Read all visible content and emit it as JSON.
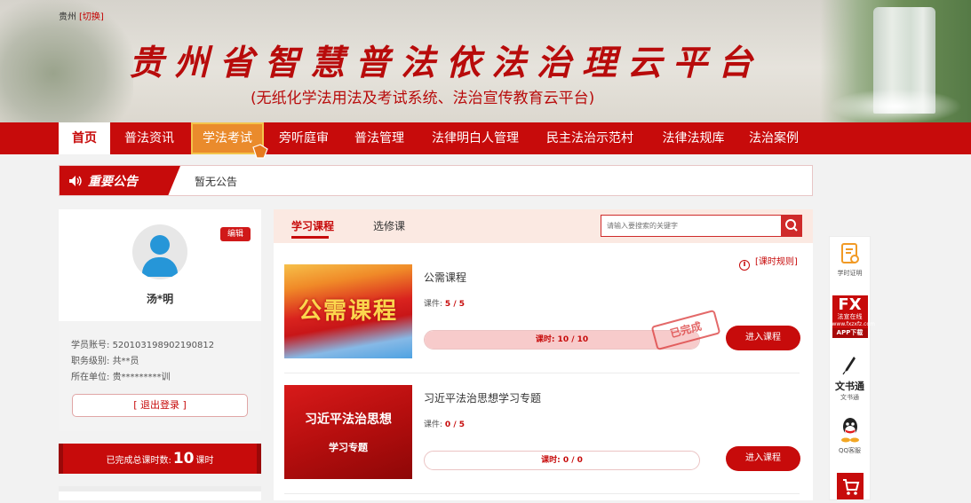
{
  "header": {
    "region": "贵州",
    "switch_label": "[切换]",
    "title": "贵州省智慧普法依法治理云平台",
    "subtitle": "(无纸化学法用法及考试系统、法治宣传教育云平台)"
  },
  "nav": {
    "items": [
      {
        "label": "首页"
      },
      {
        "label": "普法资讯"
      },
      {
        "label": "学法考试"
      },
      {
        "label": "旁听庭审"
      },
      {
        "label": "普法管理"
      },
      {
        "label": "法律明白人管理"
      },
      {
        "label": "民主法治示范村"
      },
      {
        "label": "法律法规库"
      },
      {
        "label": "法治案例"
      }
    ],
    "active_index": 0,
    "hover_index": 2
  },
  "notice": {
    "label": "重要公告",
    "text": "暂无公告"
  },
  "profile": {
    "edit_label": "编辑",
    "name": "汤*明",
    "account_label": "学员账号:",
    "account_value": "520103198902190812",
    "level_label": "职务级别:",
    "level_value": "共**员",
    "unit_label": "所在单位:",
    "unit_value": "贵*********训",
    "logout_label": "[ 退出登录 ]"
  },
  "total": {
    "prefix": "已完成总课时数:",
    "value": "10",
    "suffix": "课时"
  },
  "courses_panel": {
    "tabs": [
      {
        "label": "学习课程"
      },
      {
        "label": "选修课"
      }
    ],
    "active_tab": 0,
    "search_placeholder": "请输入要搜索的关键字",
    "rules_label": "[课时规则]",
    "courses": [
      {
        "thumb_text": "公需课程",
        "name": "公需课程",
        "lessons_label": "课件:",
        "lessons_value": "5 / 5",
        "hours_text": "课时: 10 / 10",
        "progress_fraction": 1.0,
        "stamp": "已完成",
        "button": "进入课程"
      },
      {
        "thumb_line1": "习近平法治思想",
        "thumb_line2": "学习专题",
        "name": "习近平法治思想学习专题",
        "lessons_label": "课件:",
        "lessons_value": "0 / 5",
        "hours_text": "课时: 0 / 0",
        "progress_fraction": 0.0,
        "button": "进入课程"
      }
    ]
  },
  "toolbar": {
    "items": [
      {
        "icon": "certificate-icon",
        "label": "学时证明"
      },
      {
        "icon": "fx-app-icon",
        "big": "FX",
        "line1": "法宣在线",
        "line2": "www.fxzxfz.com",
        "line3": "APP下载"
      },
      {
        "icon": "pen-icon",
        "title": "文书通",
        "label": "文书通"
      },
      {
        "icon": "qq-icon",
        "label": "QQ客服"
      },
      {
        "icon": "cart-icon"
      }
    ]
  },
  "colors": {
    "brand_red": "#c70b0b",
    "hover_orange": "#ea8b2c",
    "avatar_blue": "#2696d8"
  }
}
